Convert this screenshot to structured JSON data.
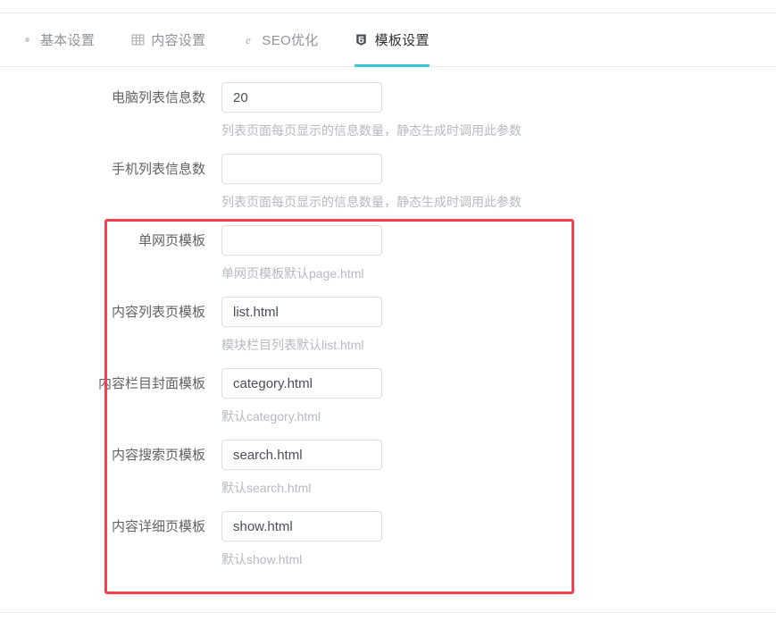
{
  "tabs": [
    {
      "icon": "gear-icon",
      "label": "基本设置",
      "active": false
    },
    {
      "icon": "grid-icon",
      "label": "内容设置",
      "active": false
    },
    {
      "icon": "ie-browser-icon",
      "label": "SEO优化",
      "active": false
    },
    {
      "icon": "html5-shield-icon",
      "label": "模板设置",
      "active": true
    }
  ],
  "form": {
    "rows": [
      {
        "label": "电脑列表信息数",
        "value": "20",
        "placeholder": "",
        "help": "列表页面每页显示的信息数量，静态生成时调用此参数"
      },
      {
        "label": "手机列表信息数",
        "value": "",
        "placeholder": "",
        "help": "列表页面每页显示的信息数量，静态生成时调用此参数"
      },
      {
        "label": "单网页模板",
        "value": "",
        "placeholder": "",
        "help": "单网页模板默认page.html"
      },
      {
        "label": "内容列表页模板",
        "value": "list.html",
        "placeholder": "",
        "help": "模块栏目列表默认list.html"
      },
      {
        "label": "内容栏目封面模板",
        "value": "category.html",
        "placeholder": "",
        "help": "默认category.html"
      },
      {
        "label": "内容搜索页模板",
        "value": "search.html",
        "placeholder": "",
        "help": "默认search.html"
      },
      {
        "label": "内容详细页模板",
        "value": "show.html",
        "placeholder": "",
        "help": "默认show.html"
      }
    ]
  },
  "annotation": {
    "name": "template-settings-highlight",
    "color": "#f5414f"
  },
  "colors": {
    "active_tab_underline": "#3ac5d6",
    "active_tab_text": "#303133",
    "inactive_tab_text": "#909399",
    "label_text": "#606266",
    "help_text": "#b6bac0",
    "input_border": "#dcdfe6",
    "rule": "#e8eaec"
  }
}
